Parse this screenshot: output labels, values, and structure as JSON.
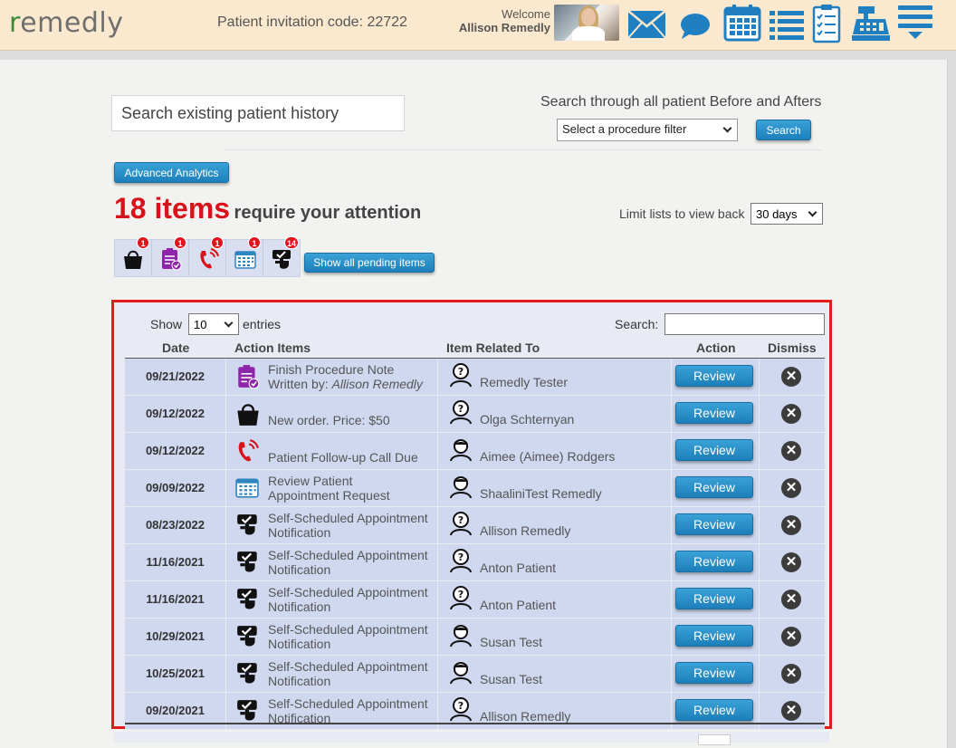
{
  "header": {
    "logo_r": "r",
    "logo_rest": "emedly",
    "invite_label": "Patient invitation code: 22722",
    "welcome": "Welcome",
    "user_name": "Allison Remedly",
    "icons": [
      "mail-icon",
      "chat-icon",
      "calendar-icon",
      "list-icon",
      "checklist-icon",
      "cash-register-icon",
      "menu-icon"
    ]
  },
  "search": {
    "placeholder": "Search existing patient history",
    "through_label": "Search through all patient Before and Afters",
    "procedure_filter": "Select a procedure filter",
    "button": "Search"
  },
  "analytics_button": "Advanced Analytics",
  "attention": {
    "count": "18 items",
    "rest": "require your attention"
  },
  "limit": {
    "label": "Limit lists to view back",
    "value": "30 days"
  },
  "pending": {
    "badges": [
      "1",
      "1",
      "1",
      "1",
      "14"
    ],
    "show_all": "Show all pending items"
  },
  "table": {
    "show": "Show",
    "entries_value": "10",
    "entries": "entries",
    "search_label": "Search:",
    "headers": {
      "date": "Date",
      "action_items": "Action Items",
      "related": "Item Related To",
      "action": "Action",
      "dismiss": "Dismiss"
    },
    "review_label": "Review",
    "dismiss_glyph": "✕",
    "rows": [
      {
        "date": "09/21/2022",
        "icon": "procedure-note-icon",
        "line1": "Finish Procedure Note",
        "line2": "Written by: ",
        "line2_em": "Allison Remedly",
        "related": "Remedly Tester",
        "person": "unknown"
      },
      {
        "date": "09/12/2022",
        "icon": "shopping-bag-icon",
        "line1": "New order. Price: $50",
        "line2": "",
        "line2_em": "",
        "related": "Olga Schternyan",
        "person": "unknown"
      },
      {
        "date": "09/12/2022",
        "icon": "phone-call-icon",
        "line1": "Patient Follow-up Call Due",
        "line2": "",
        "line2_em": "",
        "related": "Aimee (Aimee) Rodgers",
        "person": "known"
      },
      {
        "date": "09/09/2022",
        "icon": "appointment-calendar-icon",
        "line1": "Review Patient",
        "line2": "Appointment Request",
        "line2_em": "",
        "related": "ShaaliniTest Remedly",
        "person": "known"
      },
      {
        "date": "08/23/2022",
        "icon": "self-schedule-icon",
        "line1": "Self-Scheduled Appointment",
        "line2": "Notification",
        "line2_em": "",
        "related": "Allison Remedly",
        "person": "unknown"
      },
      {
        "date": "11/16/2021",
        "icon": "self-schedule-icon",
        "line1": "Self-Scheduled Appointment",
        "line2": "Notification",
        "line2_em": "",
        "related": "Anton Patient",
        "person": "unknown"
      },
      {
        "date": "11/16/2021",
        "icon": "self-schedule-icon",
        "line1": "Self-Scheduled Appointment",
        "line2": "Notification",
        "line2_em": "",
        "related": "Anton Patient",
        "person": "unknown"
      },
      {
        "date": "10/29/2021",
        "icon": "self-schedule-icon",
        "line1": "Self-Scheduled Appointment",
        "line2": "Notification",
        "line2_em": "",
        "related": "Susan Test",
        "person": "known"
      },
      {
        "date": "10/25/2021",
        "icon": "self-schedule-icon",
        "line1": "Self-Scheduled Appointment",
        "line2": "Notification",
        "line2_em": "",
        "related": "Susan Test",
        "person": "known"
      },
      {
        "date": "09/20/2021",
        "icon": "self-schedule-icon",
        "line1": "Self-Scheduled Appointment",
        "line2": "Notification",
        "line2_em": "",
        "related": "Allison Remedly",
        "person": "unknown"
      }
    ]
  },
  "colors": {
    "header_bg": "#fbe9cf",
    "accent_blue": "#1d7fba",
    "attention_red": "#d8121a",
    "row_bg": "#cfd8ee",
    "highlight_border": "#e21b1b"
  }
}
